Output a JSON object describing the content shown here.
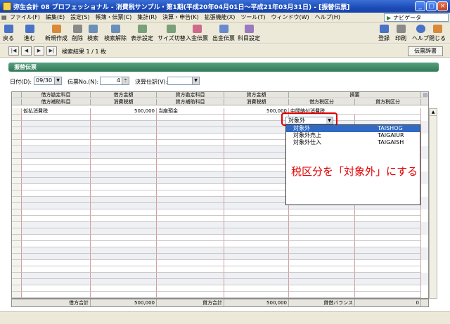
{
  "window": {
    "title": "弥生会計 08 プロフェッショナル - 消費税サンプル・第1期(平成20年04月01日～平成21年03月31日) - [振替伝票]"
  },
  "menu": {
    "items": [
      "ファイル(F)",
      "編集(E)",
      "設定(S)",
      "帳簿・伝票(C)",
      "集計(R)",
      "決算・申告(K)",
      "拡張機能(X)",
      "ツール(T)",
      "ウィンドウ(W)",
      "ヘルプ(H)"
    ],
    "navigator": "ナビゲータ"
  },
  "toolbar": {
    "left": [
      "戻る",
      "進む",
      "新規作成",
      "削除",
      "検索",
      "検索解除",
      "表示設定",
      "サイズ切替",
      "入金伝票",
      "出金伝票",
      "科目設定"
    ],
    "right": [
      "登録",
      "印刷",
      "ヘルプ",
      "閉じる"
    ]
  },
  "nav": {
    "result": "検索結果 1 / 1 枚",
    "dict_button": "伝票辞書",
    "buttons": [
      "|◀",
      "◀",
      "▶",
      "▶|"
    ]
  },
  "section": {
    "title": "振替伝票"
  },
  "filter": {
    "date_label": "日付(D):",
    "date_value": "09/30",
    "slipno_label": "伝票No.(N):",
    "slipno_value": "4",
    "adjust_label": "決算仕訳(V):",
    "adjust_value": ""
  },
  "grid": {
    "header1": [
      "借方勘定科目",
      "借方金額",
      "貸方勘定科目",
      "貸方金額",
      "摘要"
    ],
    "header2": [
      "借方補助科目",
      "消費税額",
      "貸方補助科目",
      "消費税額",
      "借方税区分",
      "貸方税区分"
    ],
    "row1": {
      "debit_account": "仮払消費税",
      "debit_amount": "500,000",
      "credit_account": "当座預金",
      "credit_amount": "500,000",
      "description": "中間納付消費税"
    }
  },
  "taxselect": {
    "value": "対象外"
  },
  "dropdown": {
    "options": [
      {
        "label": "対象外",
        "code": "TAISHOG"
      },
      {
        "label": "対象外売上",
        "code": "TAIGAIUR"
      },
      {
        "label": "対象外仕入",
        "code": "TAIGAISH"
      }
    ]
  },
  "annotation": "税区分を「対象外」にする",
  "footer": {
    "debit_total_label": "借方合計",
    "debit_total": "500,000",
    "credit_total_label": "貸方合計",
    "credit_total": "500,000",
    "balance_label": "貸借バランス",
    "balance": "0"
  },
  "colors": {
    "accent": "#2f7a58",
    "highlight": "#316ac5",
    "annotation": "#e00000"
  }
}
